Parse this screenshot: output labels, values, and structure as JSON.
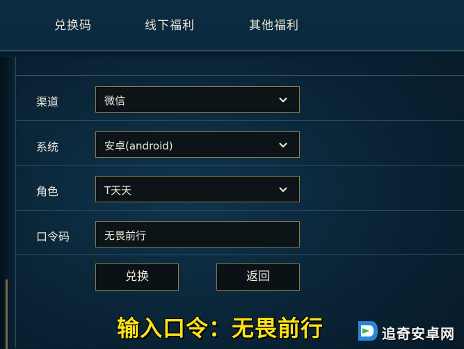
{
  "tabs": [
    "兑换码",
    "线下福利",
    "其他福利"
  ],
  "form": {
    "channel": {
      "label": "渠道",
      "value": "微信"
    },
    "system": {
      "label": "系统",
      "value": "安卓(android)"
    },
    "role": {
      "label": "角色",
      "value": "T天天"
    },
    "code": {
      "label": "口令码",
      "value": "无畏前行"
    }
  },
  "buttons": {
    "redeem": "兑换",
    "back": "返回"
  },
  "caption": "输入口令：无畏前行",
  "watermark": {
    "text": "追奇安卓网"
  },
  "colors": {
    "accent_border": "#8b7a4e",
    "caption_yellow": "#ffe21a",
    "background": "#0a2638"
  }
}
